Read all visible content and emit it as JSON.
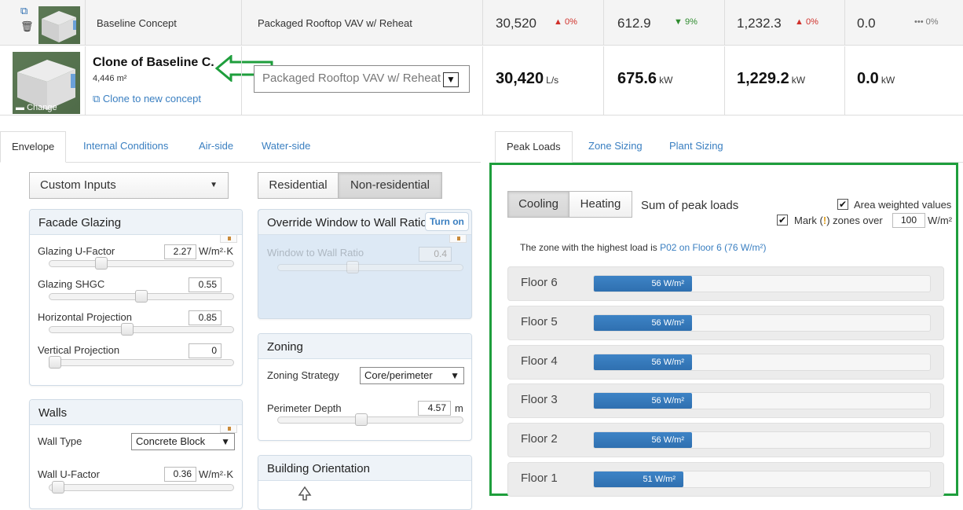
{
  "row1": {
    "concept": "Baseline Concept",
    "system": "Packaged Rooftop VAV w/ Reheat",
    "m1": {
      "value": "30,520",
      "delta": "0%",
      "dir": "up"
    },
    "m2": {
      "value": "612.9",
      "delta": "9%",
      "dir": "down"
    },
    "m3": {
      "value": "1,232.3",
      "delta": "0%",
      "dir": "up"
    },
    "m4": {
      "value": "0.0",
      "delta": "0%",
      "dir": "flat"
    }
  },
  "row2": {
    "concept": "Clone of Baseline C.",
    "area": "4,446 m²",
    "clone_link": "Clone to new concept",
    "change_label": "Change",
    "system": "Packaged Rooftop VAV w/ Reheat",
    "m1": {
      "value": "30,420",
      "unit": "L/s"
    },
    "m2": {
      "value": "675.6",
      "unit": "kW"
    },
    "m3": {
      "value": "1,229.2",
      "unit": "kW"
    },
    "m4": {
      "value": "0.0",
      "unit": "kW"
    }
  },
  "left_tabs": [
    "Envelope",
    "Internal Conditions",
    "Air-side",
    "Water-side"
  ],
  "right_tabs": [
    "Peak Loads",
    "Zone Sizing",
    "Plant Sizing"
  ],
  "inputs_select": "Custom Inputs",
  "building_type": {
    "a": "Residential",
    "b": "Non-residential",
    "active": "b"
  },
  "facade": {
    "title": "Facade Glazing",
    "fields": [
      {
        "label": "Glazing U-Factor",
        "value": "2.27",
        "unit": "W/m²·K",
        "pos": 0.27
      },
      {
        "label": "Glazing SHGC",
        "value": "0.55",
        "unit": "",
        "pos": 0.5
      },
      {
        "label": "Horizontal Projection",
        "value": "0.85",
        "unit": "",
        "pos": 0.42
      },
      {
        "label": "Vertical Projection",
        "value": "0",
        "unit": "",
        "pos": 0.0
      }
    ]
  },
  "override": {
    "title": "Override Window to Wall Ratio",
    "turn_on": "Turn on",
    "field_label": "Window to Wall Ratio",
    "value": "0.4",
    "pos": 0.4
  },
  "zoning": {
    "title": "Zoning",
    "strategy_label": "Zoning Strategy",
    "strategy_value": "Core/perimeter",
    "depth_label": "Perimeter Depth",
    "depth_value": "4.57",
    "depth_unit": "m",
    "pos": 0.45
  },
  "walls": {
    "title": "Walls",
    "type_label": "Wall Type",
    "type_value": "Concrete Block",
    "u_label": "Wall U-Factor",
    "u_value": "0.36",
    "u_unit": "W/m²·K",
    "pos": 0.02
  },
  "orientation": {
    "title": "Building Orientation"
  },
  "peak": {
    "cooling": "Cooling",
    "heating": "Heating",
    "sum_label": "Sum of peak loads",
    "area_weighted": "Area weighted values",
    "mark_prefix": "Mark (",
    "mark_suffix": ") zones over",
    "threshold": "100",
    "threshold_unit": "W/m²",
    "highest_prefix": "The zone with the highest load is",
    "highest_link": "P02 on Floor 6 (76 W/m²)",
    "bar_max": 430
  },
  "chart_data": {
    "type": "bar",
    "categories": [
      "Floor 6",
      "Floor 5",
      "Floor 4",
      "Floor 3",
      "Floor 2",
      "Floor 1"
    ],
    "values": [
      56,
      56,
      56,
      56,
      56,
      51
    ],
    "value_labels": [
      "56 W/m²",
      "56 W/m²",
      "56 W/m²",
      "56 W/m²",
      "56 W/m²",
      "51 W/m²"
    ],
    "unit": "W/m²"
  },
  "colors": {
    "accent": "#3a7fc1",
    "bar": "#3477ba",
    "highlight_box": "#1e9e3c",
    "arrow": "#1e9e3c"
  }
}
